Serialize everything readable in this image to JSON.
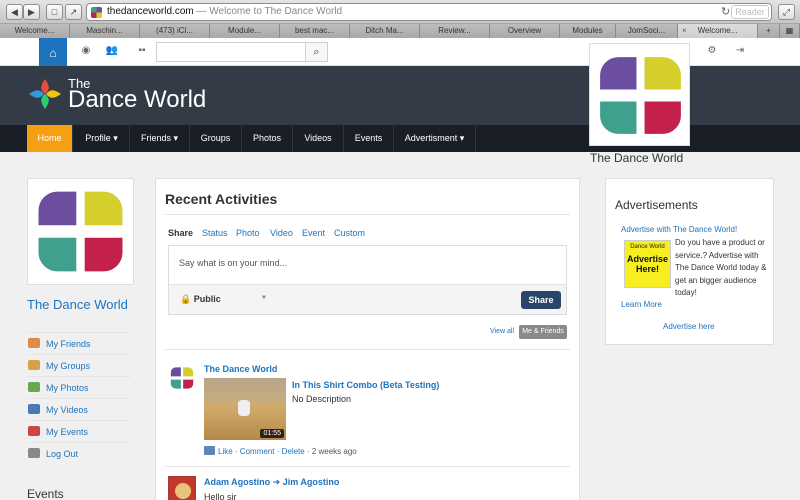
{
  "browser": {
    "url_domain": "thedanceworld.com",
    "url_sep": " — ",
    "url_title": "Welcome to The Dance World",
    "reader_label": "Reader",
    "tabs": [
      "Welcome...",
      "Maschin...",
      "(473) iCl...",
      "Module...",
      "best mac...",
      "Ditch Ma...",
      "Review...",
      "Overview",
      "Modules",
      "JomSoci...",
      "Welcome..."
    ]
  },
  "site": {
    "name_the": "The",
    "name_rest": "Dance World",
    "search_placeholder": "",
    "nav": [
      {
        "label": "Home"
      },
      {
        "label": "Profile ▾"
      },
      {
        "label": "Friends ▾"
      },
      {
        "label": "Groups"
      },
      {
        "label": "Photos"
      },
      {
        "label": "Videos"
      },
      {
        "label": "Events"
      },
      {
        "label": "Advertisment ▾"
      }
    ],
    "float_name": "The Dance World"
  },
  "sidebar": {
    "profile_name": "The Dance World",
    "links": [
      "My Friends",
      "My Groups",
      "My Photos",
      "My Videos",
      "My Events",
      "Log Out"
    ],
    "events_heading": "Events"
  },
  "activity": {
    "title": "Recent Activities",
    "share_label": "Share",
    "tabs": [
      "Status",
      "Photo",
      "Video",
      "Event",
      "Custom"
    ],
    "status_prompt": "Say what is on your mind...",
    "privacy": "Public",
    "share_button": "Share",
    "view_all": "View all",
    "me_friends": "Me & Friends",
    "items": [
      {
        "author": "The Dance World",
        "video_title": "In This Shirt Combo (Beta Testing)",
        "video_desc": "No Description",
        "duration": "01:55",
        "like": "Like",
        "comment": "Comment",
        "delete": "Delete",
        "time": "2 weeks ago"
      },
      {
        "author": "Adam Agostino ➜ Jim Agostino",
        "text": "Hello sir"
      }
    ]
  },
  "ads": {
    "title": "Advertisements",
    "link": "Advertise with The Dance World!",
    "img_brand": "Dance World",
    "img_cta": "Advertise Here!",
    "copy": "Do you have a product or service.? Advertise with The Dance World today & get an bigger audience today!",
    "learn_more": "Learn More",
    "advertise_here": "Advertise here"
  },
  "colors": {
    "accent": "#1e73be",
    "nav_active": "#f5a012",
    "header_bg": "#333b47"
  }
}
